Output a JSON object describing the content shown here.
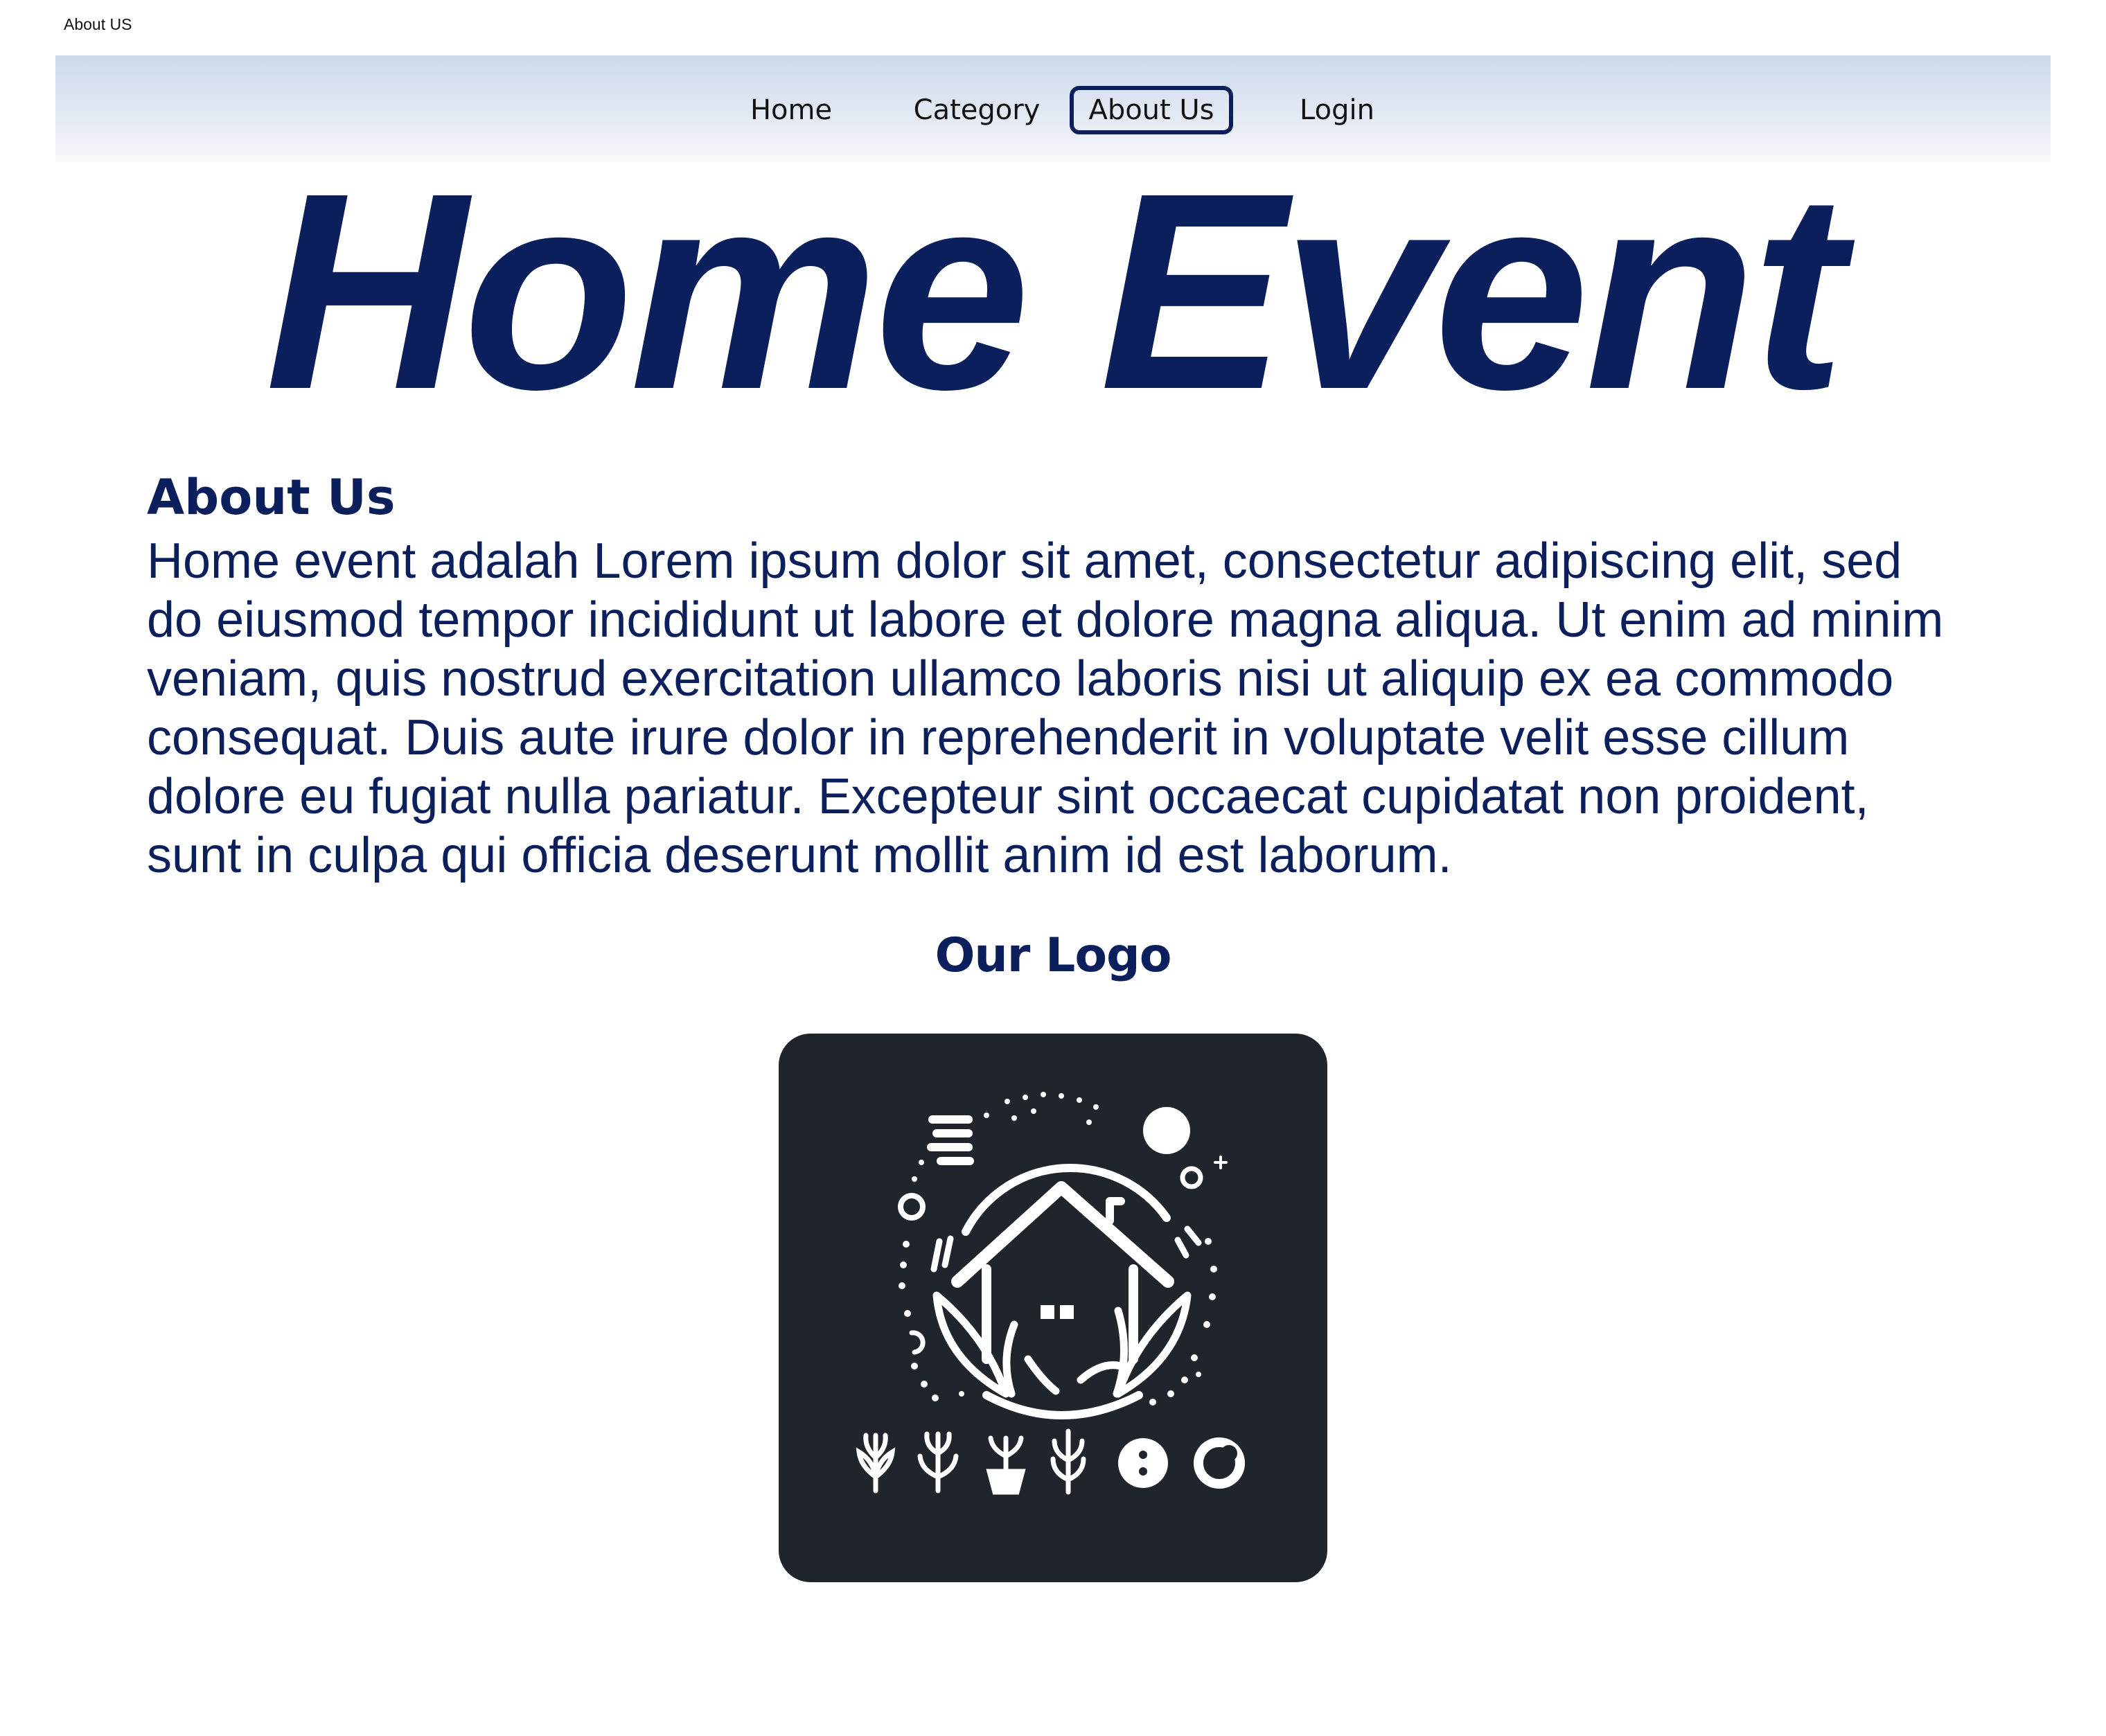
{
  "frame": {
    "label": "About US"
  },
  "nav": {
    "items": [
      {
        "label": "Home"
      },
      {
        "label": "Category"
      },
      {
        "label": "About Us",
        "active": true
      },
      {
        "label": "Login"
      }
    ]
  },
  "hero": {
    "title": "Home Event"
  },
  "about": {
    "heading": "About Us",
    "body": "Home event adalah Lorem ipsum dolor sit amet, consectetur adipiscing elit, sed do eiusmod tempor incididunt ut labore et dolore magna aliqua. Ut enim ad minim veniam, quis nostrud exercitation ullamco laboris nisi ut aliquip ex ea commodo consequat. Duis aute irure dolor in reprehenderit in voluptate velit esse cillum dolore eu fugiat nulla pariatur. Excepteur sint occaecat cupidatat non proident, sunt in culpa qui officia deserunt mollit anim id est laborum."
  },
  "logo": {
    "heading": "Our Logo",
    "icons": [
      "house-icon",
      "moon-icon",
      "sun-icon",
      "leaf-icon",
      "sprout-icon",
      "potted-plant-icon",
      "wheat-icon",
      "dots-circle-icon",
      "ring-icon"
    ]
  },
  "colors": {
    "brand_navy": "#0b1f5c",
    "nav_gradient_top": "#cdd9ee",
    "logo_background": "#1f252b",
    "logo_foreground": "#ffffff"
  }
}
